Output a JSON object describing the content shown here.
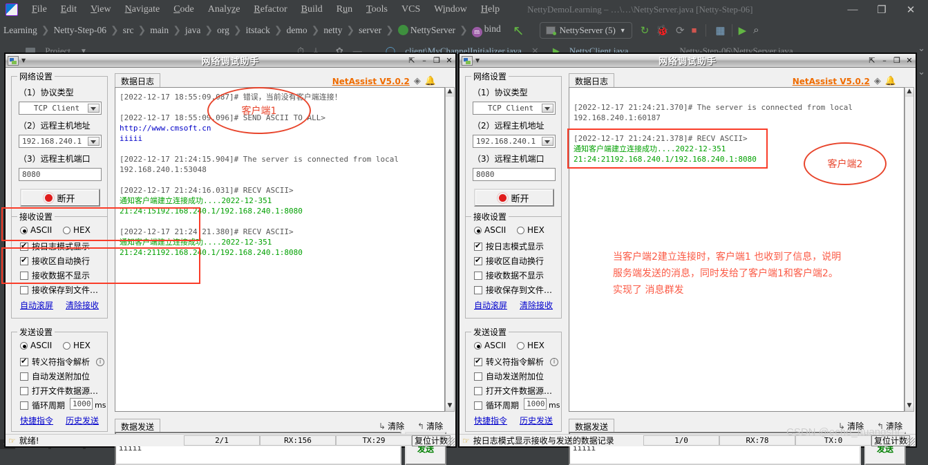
{
  "ide": {
    "logo_icon": "intellij-logo-icon",
    "menus": [
      "File",
      "Edit",
      "View",
      "Navigate",
      "Code",
      "Analyze",
      "Refactor",
      "Build",
      "Run",
      "Tools",
      "VCS",
      "Window",
      "Help"
    ],
    "window_title": "NettyDemoLearning – …\\…\\NettyServer.java [Netty-Step-06]",
    "window_buttons": [
      "—",
      "❐",
      "✕"
    ],
    "breadcrumbs": [
      "Learning",
      "Netty-Step-06",
      "src",
      "main",
      "java",
      "org",
      "itstack",
      "demo",
      "netty",
      "server",
      "NettyServer",
      "bind"
    ],
    "run_config": "NettyServer (5)",
    "toolbar_icons": [
      "rerun-icon",
      "debug-icon",
      "coverage-icon",
      "stop-icon",
      "project-structure-icon",
      "run-anything-icon",
      "search-icon"
    ],
    "tool_window_label": "Project",
    "editor_tab_left": "client\\MyChannelInitializer.java",
    "editor_tab_right": "NettyClient.java",
    "editor_tab_far": "Netty-Step-06\\NettyServer.java"
  },
  "windows": [
    {
      "id": "left",
      "title": "网络调试助手",
      "title_buttons": [
        "⇱",
        "–",
        "❐",
        "✕"
      ],
      "brand": "NetAssist V5.0.2",
      "brand_icons": [
        "diamond-icon",
        "bell-icon"
      ],
      "network_settings": {
        "group_title": "网络设置",
        "protocol_label": "（1）协议类型",
        "protocol_value": "TCP Client",
        "host_label": "（2）远程主机地址",
        "host_value": "192.168.240.1",
        "port_label": "（3）远程主机端口",
        "port_value": "8080",
        "connect_button": "断开"
      },
      "recv_settings": {
        "group_title": "接收设置",
        "ascii": "ASCII",
        "hex": "HEX",
        "mode": "ASCII",
        "checks": [
          {
            "label": "按日志模式显示",
            "checked": true
          },
          {
            "label": "接收区自动换行",
            "checked": true
          },
          {
            "label": "接收数据不显示",
            "checked": false
          },
          {
            "label": "接收保存到文件…",
            "checked": false
          }
        ],
        "links": [
          "自动滚屏",
          "清除接收"
        ]
      },
      "send_settings": {
        "group_title": "发送设置",
        "ascii": "ASCII",
        "hex": "HEX",
        "mode": "ASCII",
        "checks": [
          {
            "label": "转义符指令解析",
            "checked": true,
            "info": true
          },
          {
            "label": "自动发送附加位",
            "checked": false
          },
          {
            "label": "打开文件数据源…",
            "checked": false
          }
        ],
        "cycle_label": "循环周期",
        "cycle_value": "1000",
        "cycle_unit": "ms",
        "cycle_checked": false,
        "links": [
          "快捷指令",
          "历史发送"
        ]
      },
      "log_tab": "数据日志",
      "log_lines": [
        {
          "text": "[2022-12-17 18:55:09.087]# 错误，当前没有客户端连接！",
          "color": "gray"
        },
        {
          "text": "",
          "color": "gray"
        },
        {
          "text": "[2022-12-17 18:55:09.096]# SEND ASCII TO ALL>",
          "color": "gray"
        },
        {
          "text": "http://www.cmsoft.cn",
          "color": "blue"
        },
        {
          "text": "iiiii",
          "color": "blue"
        },
        {
          "text": "",
          "color": "gray"
        },
        {
          "text": "[2022-12-17 21:24:15.904]# The server is connected from local",
          "color": "gray"
        },
        {
          "text": "192.168.240.1:53048",
          "color": "gray"
        },
        {
          "text": "",
          "color": "gray"
        },
        {
          "text": "[2022-12-17 21:24:16.031]# RECV ASCII>",
          "color": "gray"
        },
        {
          "text": "通知客户端建立连接成功....2022-12-351",
          "color": "green"
        },
        {
          "text": "21:24:15192.168.240.1/192.168.240.1:8080",
          "color": "green"
        },
        {
          "text": "",
          "color": "gray"
        },
        {
          "text": "[2022-12-17 21:24:21.380]# RECV ASCII>",
          "color": "gray"
        },
        {
          "text": "通知客户端建立连接成功....2022-12-351",
          "color": "green"
        },
        {
          "text": "21:24:21192.168.240.1/192.168.240.1:8080",
          "color": "green"
        }
      ],
      "send_panel": {
        "tab": "数据发送",
        "clear_left": "清除",
        "clear_right": "清除",
        "content": "http://www.cmsoft.cn\niiiii",
        "send_button": "发送"
      },
      "status": {
        "hint": "就绪!",
        "cells": [
          "2/1",
          "RX:156",
          "TX:29"
        ],
        "reset": "复位计数"
      },
      "annotation_ellipse": "客户端1"
    },
    {
      "id": "right",
      "title": "网络调试助手",
      "title_buttons": [
        "⇱",
        "–",
        "❐",
        "✕"
      ],
      "brand": "NetAssist V5.0.2",
      "brand_icons": [
        "diamond-icon",
        "bell-icon"
      ],
      "network_settings": {
        "group_title": "网络设置",
        "protocol_label": "（1）协议类型",
        "protocol_value": "TCP Client",
        "host_label": "（2）远程主机地址",
        "host_value": "192.168.240.1",
        "port_label": "（3）远程主机端口",
        "port_value": "8080",
        "connect_button": "断开"
      },
      "recv_settings": {
        "group_title": "接收设置",
        "ascii": "ASCII",
        "hex": "HEX",
        "mode": "ASCII",
        "checks": [
          {
            "label": "按日志模式显示",
            "checked": true
          },
          {
            "label": "接收区自动换行",
            "checked": true
          },
          {
            "label": "接收数据不显示",
            "checked": false
          },
          {
            "label": "接收保存到文件…",
            "checked": false
          }
        ],
        "links": [
          "自动滚屏",
          "清除接收"
        ]
      },
      "send_settings": {
        "group_title": "发送设置",
        "ascii": "ASCII",
        "hex": "HEX",
        "mode": "ASCII",
        "checks": [
          {
            "label": "转义符指令解析",
            "checked": true,
            "info": true
          },
          {
            "label": "自动发送附加位",
            "checked": false
          },
          {
            "label": "打开文件数据源…",
            "checked": false
          }
        ],
        "cycle_label": "循环周期",
        "cycle_value": "1000",
        "cycle_unit": "ms",
        "cycle_checked": false,
        "links": [
          "快捷指令",
          "历史发送"
        ]
      },
      "log_tab": "数据日志",
      "log_lines": [
        {
          "text": "",
          "color": "gray"
        },
        {
          "text": "[2022-12-17 21:24:21.370]# The server is connected from local",
          "color": "gray"
        },
        {
          "text": "192.168.240.1:60187",
          "color": "gray"
        },
        {
          "text": "",
          "color": "gray"
        },
        {
          "text": "[2022-12-17 21:24:21.378]# RECV ASCII>",
          "color": "gray"
        },
        {
          "text": "通知客户端建立连接成功....2022-12-351",
          "color": "green"
        },
        {
          "text": "21:24:21192.168.240.1/192.168.240.1:8080",
          "color": "green"
        }
      ],
      "send_panel": {
        "tab": "数据发送",
        "clear_left": "清除",
        "clear_right": "清除",
        "content": "http://www.cmsoft.cn\niiiii",
        "send_button": "发送"
      },
      "status": {
        "hint": "按日志模式显示接收与发送的数据记录",
        "cells": [
          "1/0",
          "RX:78",
          "TX:0"
        ],
        "reset": "复位计数"
      },
      "annotation_ellipse": "客户端2",
      "annotation_text": "当客户端2建立连接时，客户端1 也收到了信息，说明\n服务端发送的消息，同时发给了客户端1和客户端2。\n实现了 消息群发"
    }
  ],
  "watermark": "CSDN @echo_huangshi",
  "colors": {
    "annotation_red": "#fa3c28",
    "annotation_text": "#fb5a45",
    "log_green": "#00a000",
    "log_blue": "#0000c8",
    "brand_orange": "#ef6c00",
    "ide_bg": "#3c3f41",
    "send_green": "#008000"
  }
}
